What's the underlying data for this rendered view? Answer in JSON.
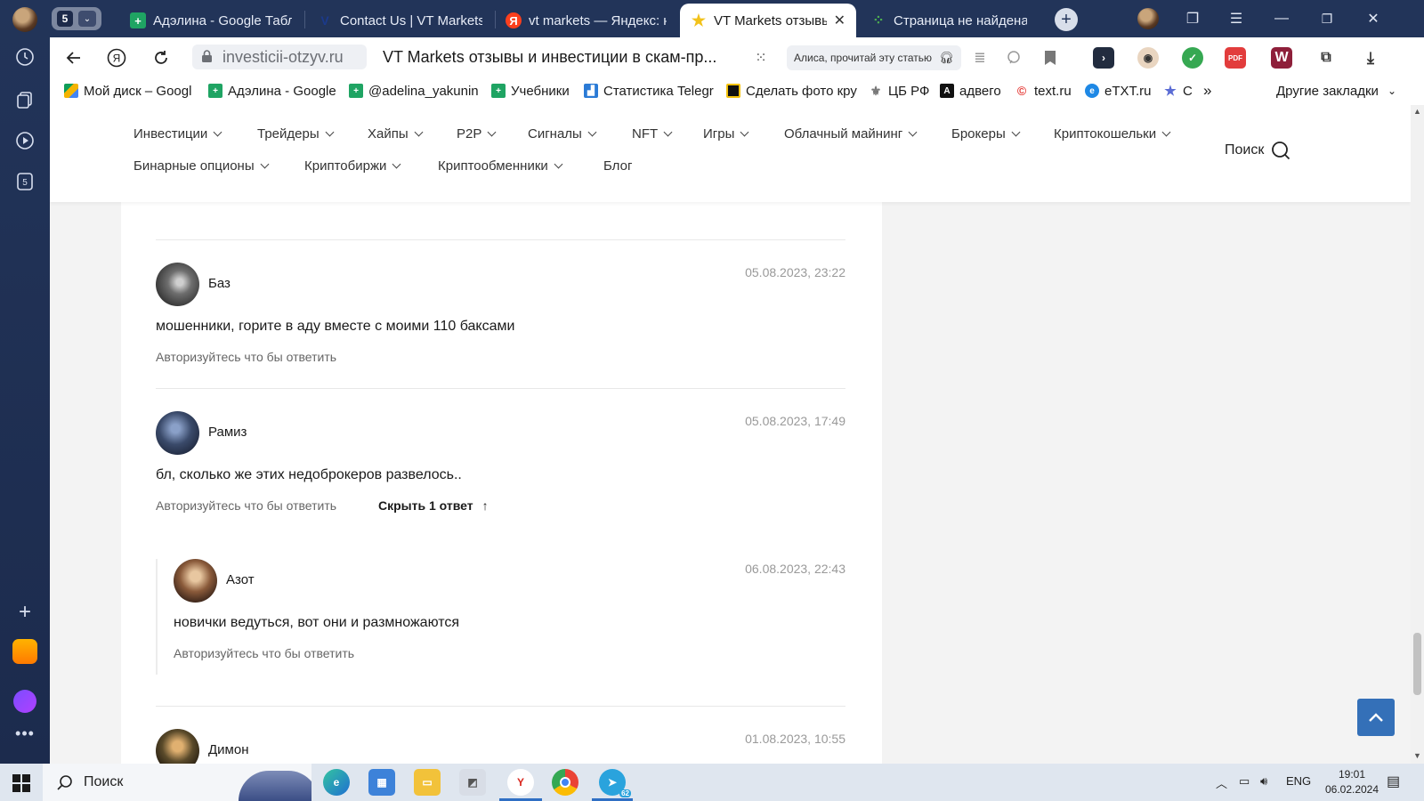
{
  "browser": {
    "tab_count": "5",
    "tabs": [
      {
        "title": "Адэлина - Google Табл",
        "favicon": "sheets-icon",
        "color": "#1fa463"
      },
      {
        "title": "Contact Us | VT Markets",
        "favicon": "vt-icon",
        "color": "#1b3a8c"
      },
      {
        "title": "vt markets — Яндекс: н",
        "favicon": "yandex-icon",
        "color": "#fc3f1d"
      },
      {
        "title": "VT Markets отзывы и",
        "favicon": "star-icon",
        "color": "#f2c21a"
      },
      {
        "title": "Страница не найдена",
        "favicon": "grid-icon",
        "color": "#4caf50"
      }
    ],
    "url": "investicii-otzyv.ru",
    "page_title": "VT Markets отзывы и инвестиции в скам-пр...",
    "alice_label": "Алиса, прочитай эту статью",
    "bookmarks": [
      {
        "label": "Мой диск – Googl",
        "icon": "drive-icon",
        "color": "#f4b400"
      },
      {
        "label": "Адэлина - Google",
        "icon": "sheets-icon",
        "color": "#1fa463"
      },
      {
        "label": "@adelina_yakunin",
        "icon": "sheets-icon",
        "color": "#1fa463"
      },
      {
        "label": "Учебники",
        "icon": "sheets-icon",
        "color": "#1fa463"
      },
      {
        "label": "Статистика Telegr",
        "icon": "stats-icon",
        "color": "#2b7bd6"
      },
      {
        "label": "Сделать фото кру",
        "icon": "photo-icon",
        "color": "#111111"
      },
      {
        "label": "ЦБ РФ",
        "icon": "eagle-icon",
        "color": "#777777"
      },
      {
        "label": "адвего",
        "icon": "advego-icon",
        "color": "#111111"
      },
      {
        "label": "text.ru",
        "icon": "textru-icon",
        "color": "#e53935"
      },
      {
        "label": "eTXT.ru",
        "icon": "etxt-icon",
        "color": "#1e88e5"
      },
      {
        "label": "С",
        "icon": "star-icon",
        "color": "#5b6cd4"
      }
    ],
    "other_bookmarks": "Другие закладки"
  },
  "site": {
    "menu_row1": [
      {
        "label": "Инвестиции",
        "dropdown": true
      },
      {
        "label": "Трейдеры",
        "dropdown": true
      },
      {
        "label": "Хайпы",
        "dropdown": true
      },
      {
        "label": "P2P",
        "dropdown": true
      },
      {
        "label": "Сигналы",
        "dropdown": true
      },
      {
        "label": "NFT",
        "dropdown": true
      },
      {
        "label": "Игры",
        "dropdown": true
      },
      {
        "label": "Облачный майнинг",
        "dropdown": true
      },
      {
        "label": "Брокеры",
        "dropdown": true
      },
      {
        "label": "Криптокошельки",
        "dropdown": true
      }
    ],
    "menu_row2": [
      {
        "label": "Бинарные опционы",
        "dropdown": true
      },
      {
        "label": "Криптобиржи",
        "dropdown": true
      },
      {
        "label": "Криптообменники",
        "dropdown": true
      },
      {
        "label": "Блог",
        "dropdown": false
      }
    ],
    "search_label": "Поиск"
  },
  "comments": [
    {
      "author": "Баз",
      "date": "05.08.2023, 23:22",
      "text": "мошенники, горите в аду вместе с моими 110 баксами",
      "reply_link": "Авторизуйтесь что бы ответить",
      "avatar_color": "#6e6e6e"
    },
    {
      "author": "Рамиз",
      "date": "05.08.2023, 17:49",
      "text": "бл, сколько же этих недоброкеров развелось..",
      "reply_link": "Авторизуйтесь что бы ответить",
      "hide_replies": "Скрыть 1 ответ",
      "avatar_color": "#3a4a6a"
    },
    {
      "author": "Азот",
      "date": "06.08.2023, 22:43",
      "text": "новички ведуться, вот они и размножаются",
      "reply_link": "Авторизуйтесь что бы ответить",
      "avatar_color": "#8a5a3a"
    },
    {
      "author": "Димон",
      "date": "01.08.2023, 10:55",
      "avatar_color": "#5a4a2a"
    }
  ],
  "taskbar": {
    "search_label": "Поиск",
    "lang": "ENG",
    "time": "19:01",
    "date": "06.02.2024",
    "telegram_badge": "62"
  }
}
